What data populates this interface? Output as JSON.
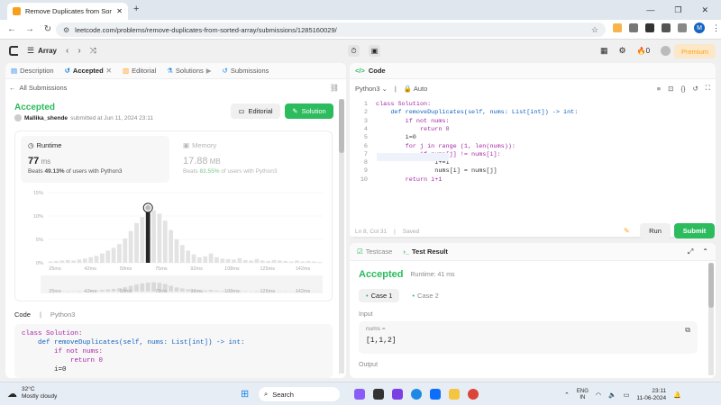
{
  "browser": {
    "tab_title": "Remove Duplicates from Sorte",
    "url": "leetcode.com/problems/remove-duplicates-from-sorted-array/submissions/1285160029/"
  },
  "lc_header": {
    "problem_list": "Array",
    "streak": "0",
    "premium": "Premium"
  },
  "left_tabs": [
    {
      "label": "Description"
    },
    {
      "label": "Accepted"
    },
    {
      "label": "Editorial"
    },
    {
      "label": "Solutions"
    },
    {
      "label": "Submissions"
    }
  ],
  "submission": {
    "back_label": "All Submissions",
    "status": "Accepted",
    "user": "Mallika_shende",
    "submitted_at": "submitted at Jun 11, 2024 23:11",
    "editorial_btn": "Editorial",
    "solution_btn": "Solution"
  },
  "runtime": {
    "title": "Runtime",
    "value": "77",
    "unit": "ms",
    "beats_prefix": "Beats",
    "beats_pct": "49.13%",
    "beats_suffix": "of users with Python3"
  },
  "memory": {
    "title": "Memory",
    "value": "17.88",
    "unit": "MB",
    "beats_prefix": "Beats",
    "beats_pct": "83.55%",
    "beats_suffix": "of users with Python3"
  },
  "chart_data": {
    "type": "bar",
    "title": "",
    "xlabel": "",
    "ylabel": "",
    "ylim": [
      0,
      15
    ],
    "yticks": [
      "15%",
      "10%",
      "5%",
      "0%"
    ],
    "xticks": [
      "25ms",
      "42ms",
      "59ms",
      "75ms",
      "92ms",
      "108ms",
      "125ms",
      "142ms"
    ],
    "series": [
      {
        "values": [
          0.3,
          0.4,
          0.5,
          0.6,
          0.5,
          0.7,
          0.9,
          1.2,
          1.5,
          2.0,
          2.6,
          3.2,
          4.0,
          5.2,
          6.8,
          8.5,
          9.8,
          10.8,
          11.2,
          10.5,
          9.0,
          7.0,
          5.0,
          3.8,
          2.6,
          1.8,
          1.2,
          1.4,
          2.0,
          1.2,
          0.9,
          0.8,
          0.7,
          1.0,
          0.6,
          0.5,
          0.8,
          0.5,
          0.4,
          0.6,
          0.5,
          0.4,
          0.3,
          0.5,
          0.3,
          0.4,
          0.3,
          0.2
        ]
      }
    ],
    "highlight_index": 17
  },
  "code_section": {
    "label": "Code",
    "language": "Python3"
  },
  "solution_code_preview": [
    "class Solution:",
    "    def removeDuplicates(self, nums: List[int]) -> int:",
    "        if not nums:",
    "            return 0",
    "        i=0"
  ],
  "editor": {
    "tab": "Code",
    "language": "Python3",
    "mode": "Auto",
    "status": "Ln 8, Col 31",
    "saved": "Saved",
    "lines": [
      "class Solution:",
      "    def removeDuplicates(self, nums: List[int]) -> int:",
      "        if not nums:",
      "            return 0",
      "        i=0",
      "        for j in range (1, len(nums)):",
      "            if nums[j] != nums[i]:",
      "                i+=1",
      "                nums[i] = nums[j]",
      "        return i+1"
    ],
    "line_numbers": [
      "1",
      "2",
      "3",
      "4",
      "5",
      "6",
      "7",
      "8",
      "9",
      "10"
    ],
    "run": "Run",
    "submit": "Submit"
  },
  "testpanel": {
    "tab_testcase": "Testcase",
    "tab_result": "Test Result",
    "status": "Accepted",
    "runtime": "Runtime: 41 ms",
    "cases": [
      "Case 1",
      "Case 2"
    ],
    "input_label": "Input",
    "var_name": "nums =",
    "var_value": "[1,1,2]",
    "output_label": "Output"
  },
  "taskbar": {
    "temp": "32°C",
    "weather": "Mostly cloudy",
    "search": "Search",
    "lang1": "ENG",
    "lang2": "IN",
    "time": "23:11",
    "date": "11-06-2024"
  }
}
